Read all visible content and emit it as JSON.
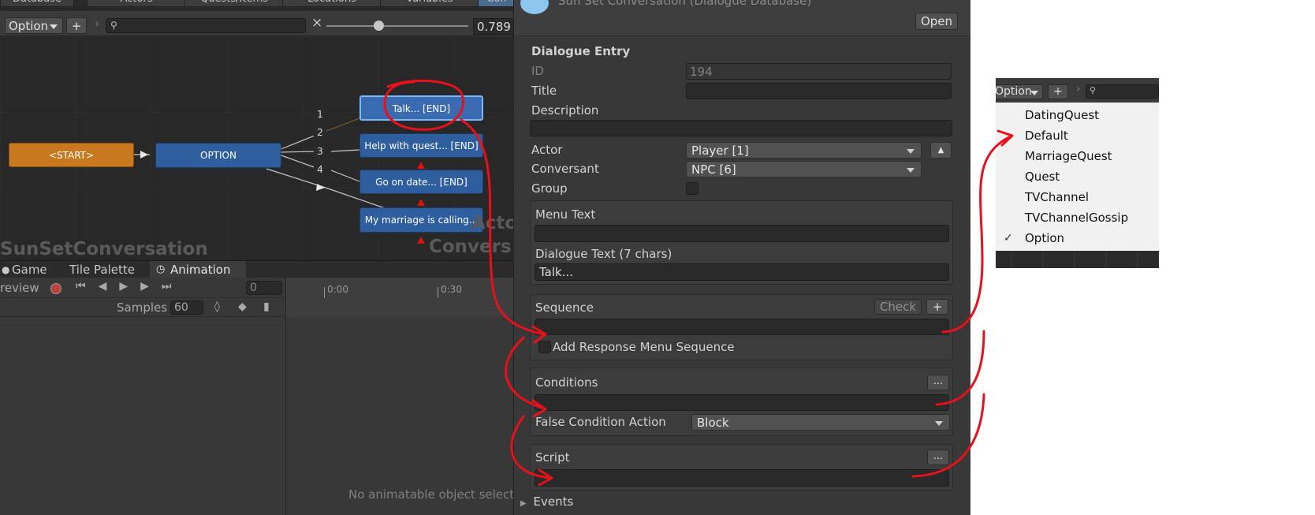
{
  "graph": {
    "top_tabs": [
      "Database",
      "Actors",
      "Quests/Items",
      "Locations",
      "Variables",
      "Con"
    ],
    "toolbar": {
      "menu_selected": "Option",
      "add_label": "+",
      "chevron": "›",
      "search_placeholder": "",
      "clear_label": "×",
      "zoom_value": "0.789"
    },
    "nodes": {
      "start": "<START>",
      "option": "OPTION",
      "talk": "Talk... [END]",
      "help": "Help with quest... [END]",
      "date": "Go on date... [END]",
      "marriage": "My marriage is calling..."
    },
    "ports": [
      "1",
      "2",
      "3",
      "4"
    ],
    "conversation_title": "SunSetConversation",
    "watermark_line1": "Acto",
    "watermark_line2": "Convers"
  },
  "bottom_panel": {
    "tabs": [
      "Game",
      "Tile Palette",
      "Animation"
    ],
    "preview_label": "review",
    "frame_value": "0",
    "samples_label": "Samples",
    "samples_value": "60",
    "timeline_marks": [
      "0:00",
      "0:30"
    ],
    "empty_message": "No animatable object selecte"
  },
  "inspector": {
    "header_title": "Sun Set Conversation (Dialogue Database)",
    "open_button": "Open",
    "section_title": "Dialogue Entry",
    "id_label": "ID",
    "id_value": "194",
    "title_label": "Title",
    "title_value": "",
    "description_label": "Description",
    "description_value": "",
    "actor_label": "Actor",
    "actor_value": "Player [1]",
    "conversant_label": "Conversant",
    "conversant_value": "NPC [6]",
    "group_label": "Group",
    "menu_text_label": "Menu Text",
    "menu_text_value": "",
    "dialogue_text_label": "Dialogue Text (7 chars)",
    "dialogue_text_value": "Talk...",
    "sequence_label": "Sequence",
    "check_button": "Check",
    "plus_button": "+",
    "sequence_value": "",
    "add_response_label": "Add Response Menu Sequence",
    "conditions_label": "Conditions",
    "ellipsis_button": "...",
    "conditions_value": "",
    "false_condition_label": "False Condition Action",
    "false_condition_value": "Block",
    "script_label": "Script",
    "script_value": "",
    "events_label": "Events"
  },
  "popup": {
    "toolbar": {
      "menu_selected": "Option",
      "add_label": "+",
      "chevron": "›"
    },
    "items": [
      "DatingQuest",
      "Default",
      "MarriageQuest",
      "Quest",
      "TVChannel",
      "TVChannelGossip",
      "Option"
    ],
    "checked_mark": "✓"
  },
  "colors": {
    "annotation_red": "#e8101a",
    "start_node": "#c8781e",
    "dialogue_node": "#2f5e9e",
    "selected_outline": "#79b8ff",
    "inspector_bg": "#383838",
    "graph_bg": "#282828"
  }
}
